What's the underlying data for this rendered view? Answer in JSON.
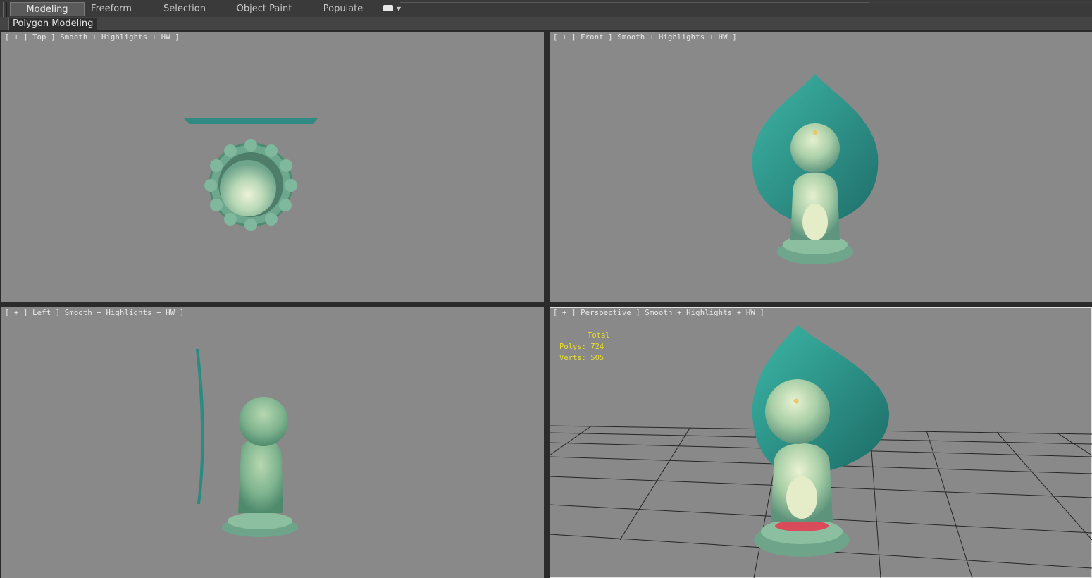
{
  "ribbon": {
    "tabs": [
      {
        "label": "Modeling",
        "active": true
      },
      {
        "label": "Freeform",
        "active": false
      },
      {
        "label": "Selection",
        "active": false
      },
      {
        "label": "Object Paint",
        "active": false
      },
      {
        "label": "Populate",
        "active": false
      }
    ],
    "panel_label": "Polygon Modeling"
  },
  "viewports": {
    "top": {
      "label": "[ + ] Top ] Smooth + Highlights + HW ]"
    },
    "front": {
      "label": "[ + ] Front ] Smooth + Highlights + HW ]"
    },
    "left": {
      "label": "[ + ] Left ] Smooth + Highlights + HW ]"
    },
    "perspective": {
      "label": "[ + ] Perspective ] Smooth + Highlights + HW ]"
    }
  },
  "stats": {
    "total_label": "Total",
    "polys_label": "Polys:",
    "polys_value": "724",
    "verts_label": "Verts:",
    "verts_value": "505",
    "color": "#e8df2a"
  },
  "colors": {
    "viewport_bg": "#898989",
    "jade": "#7fb89a",
    "halo": "#2f9a8c"
  }
}
